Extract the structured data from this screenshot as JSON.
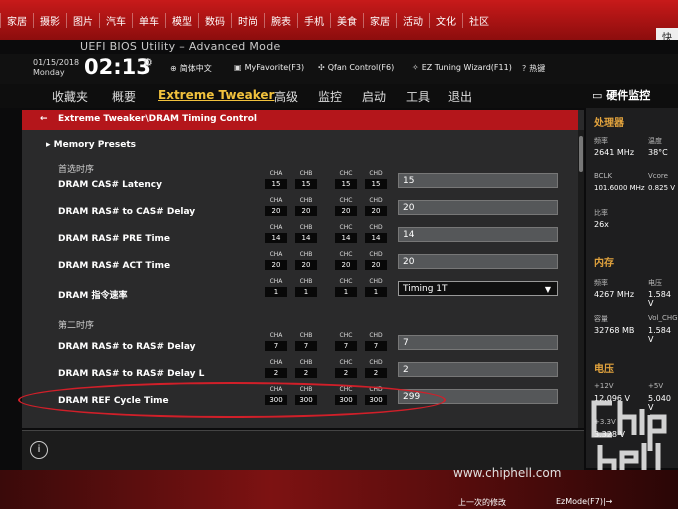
{
  "web_nav": {
    "items": [
      "家居",
      "摄影",
      "图片",
      "汽车",
      "单车",
      "模型",
      "数码",
      "时尚",
      "腕表",
      "手机",
      "美食",
      "家居",
      "活动",
      "文化",
      "社区"
    ],
    "right_label": "快"
  },
  "bios": {
    "title": "UEFI BIOS Utility – Advanced Mode",
    "date": "01/15/2018",
    "day": "Monday",
    "time": "02:13",
    "toolbar": {
      "language": "简体中文",
      "myfavorite": "MyFavorite(F3)",
      "qfan": "Qfan Control(F6)",
      "ez_tuning": "EZ Tuning Wizard(F11)",
      "hotkeys": "热键"
    },
    "tabs": [
      "收藏夹",
      "概要",
      "Extreme Tweaker",
      "高级",
      "监控",
      "启动",
      "工具",
      "退出"
    ],
    "active_tab": "Extreme Tweaker",
    "breadcrumb": "Extreme Tweaker\\DRAM Timing Control",
    "memory_presets": "Memory Presets",
    "section_primary": "首选时序",
    "section_secondary": "第二时序",
    "channel_headers": [
      "CHA",
      "CHB",
      "CHC",
      "CHD"
    ],
    "rows": [
      {
        "label": "DRAM CAS# Latency",
        "ch": [
          "15",
          "15",
          "15",
          "15"
        ],
        "value": "15"
      },
      {
        "label": "DRAM RAS# to CAS# Delay",
        "ch": [
          "20",
          "20",
          "20",
          "20"
        ],
        "value": "20"
      },
      {
        "label": "DRAM RAS# PRE Time",
        "ch": [
          "14",
          "14",
          "14",
          "14"
        ],
        "value": "14"
      },
      {
        "label": "DRAM RAS# ACT Time",
        "ch": [
          "20",
          "20",
          "20",
          "20"
        ],
        "value": "20"
      },
      {
        "label": "DRAM 指令速率",
        "ch": [
          "1",
          "1",
          "1",
          "1"
        ],
        "value": "Timing 1T"
      },
      {
        "label": "DRAM RAS# to RAS# Delay",
        "ch": [
          "7",
          "7",
          "7",
          "7"
        ],
        "value": "7"
      },
      {
        "label": "DRAM RAS# to RAS# Delay L",
        "ch": [
          "2",
          "2",
          "2",
          "2"
        ],
        "value": "2"
      },
      {
        "label": "DRAM REF Cycle Time",
        "ch": [
          "300",
          "300",
          "300",
          "300"
        ],
        "value": "299"
      }
    ],
    "hardware_monitor": {
      "title": "硬件监控",
      "cpu_header": "处理器",
      "freq_label": "频率",
      "freq_value": "2641 MHz",
      "temp_label": "温度",
      "temp_value": "38°C",
      "bclk_label": "BCLK",
      "bclk_value": "101.6000 MHz",
      "vcore_label": "Vcore",
      "vcore_value": "0.825 V",
      "ratio_label": "比率",
      "ratio_value": "26x",
      "mem_header": "内存",
      "mem_freq_label": "频率",
      "mem_freq_value": "4267 MHz",
      "mem_volt_label": "电压",
      "mem_volt_value": "1.584 V",
      "cap_label": "容量",
      "cap_value": "32768 MB",
      "volchg_label": "Vol_CHG",
      "volchg_value": "1.584 V",
      "volt_header": "电压",
      "v12_label": "+12V",
      "v12_value": "12.096 V",
      "v5_label": "+5V",
      "v5_value": "5.040 V",
      "v33_label": "+3.3V",
      "v33_value": "3.328 V"
    }
  },
  "watermark": "www.chiphell.com",
  "bottom_bar": {
    "left_note": "上一次的修改",
    "ezmode": "EzMode(F7)|→"
  }
}
